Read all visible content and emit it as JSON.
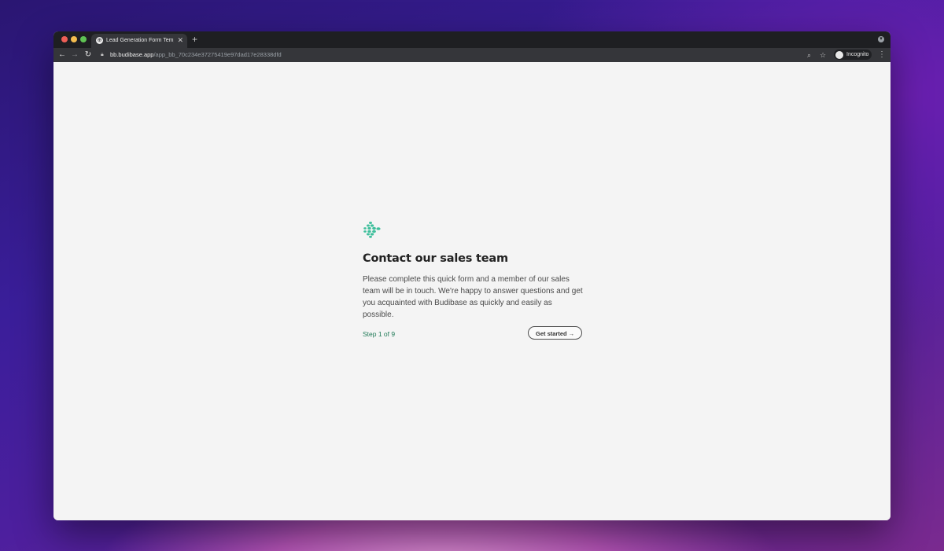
{
  "browser": {
    "tab_title": "Lead Generation Form Templat",
    "tab_close": "✕",
    "new_tab": "+",
    "url_host": "bb.budibase.app",
    "url_path": "/app_bb_70c234e37275419e97dad17e28338dfd",
    "profile_label": "Incognito",
    "icons": {
      "back": "back-arrow-icon",
      "forward": "forward-arrow-icon",
      "reload": "reload-icon",
      "lock": "lock-icon",
      "zoom": "zoom-icon",
      "bookmark": "star-icon",
      "menu": "more-vert-icon"
    }
  },
  "page": {
    "heading": "Contact our sales team",
    "description": "Please complete this quick form and a member of our sales team will be in touch. We're happy to answer questions and get you acquainted with Budibase as quickly and easily as possible.",
    "step_text": "Step 1 of 9",
    "button_label": "Get started →"
  },
  "colors": {
    "page_background": "#f4f4f4",
    "heading": "#222222",
    "body_text": "#4a4a4a",
    "step_text": "#1f7a57",
    "logo": "#3fbf9c",
    "browser_chrome": "#35363a"
  }
}
